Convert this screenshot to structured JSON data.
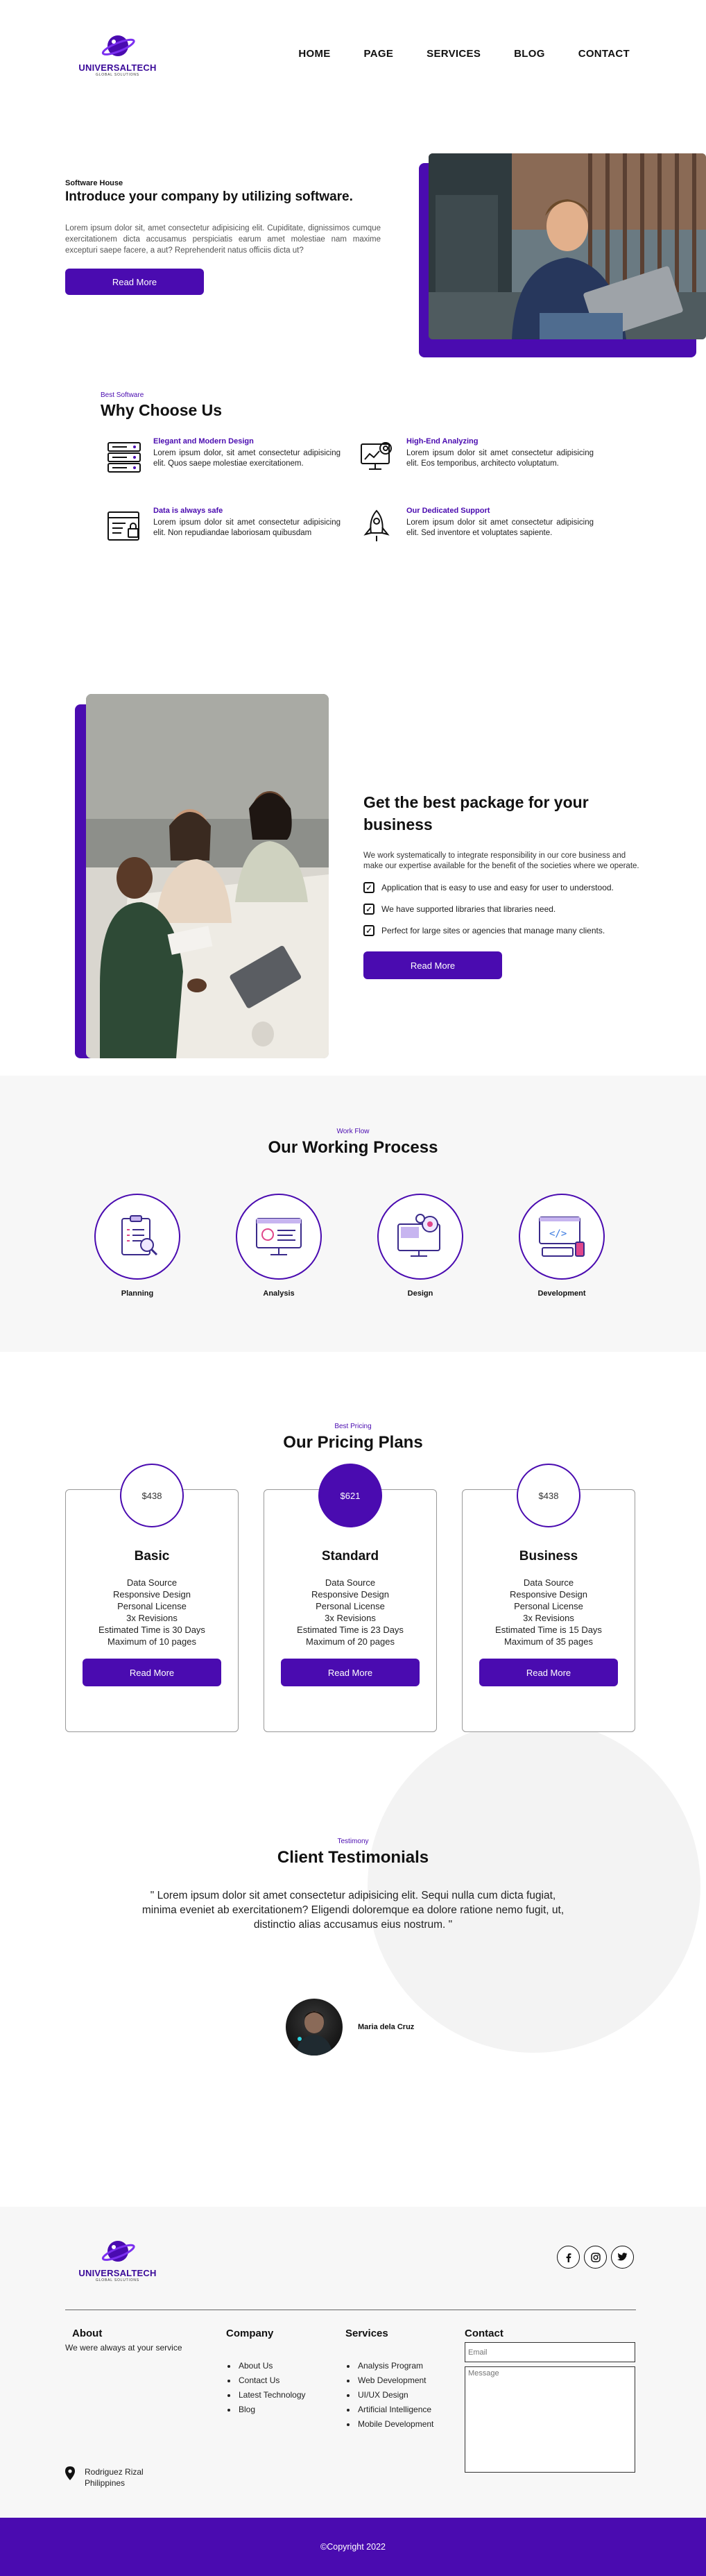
{
  "brand": {
    "name_part1": "UNIVERSAL",
    "name_part2": "TECH",
    "tagline": "GLOBAL SOLUTIONS"
  },
  "nav": {
    "items": [
      "HOME",
      "PAGE",
      "SERVICES",
      "BLOG",
      "CONTACT"
    ]
  },
  "hero": {
    "eyebrow": "Software House",
    "title": "Introduce your company by utilizing software.",
    "body": "Lorem ipsum dolor sit, amet consectetur adipisicing elit. Cupiditate, dignissimos cumque exercitationem dicta accusamus perspiciatis earum amet molestiae nam maxime excepturi saepe facere, a aut? Reprehenderit natus officiis dicta ut?",
    "button": "Read More"
  },
  "why": {
    "eyebrow": "Best Software",
    "title": "Why Choose Us",
    "features": [
      {
        "title": "Elegant and Modern Design",
        "desc": "Lorem ipsum dolor, sit amet consectetur adipisicing elit. Quos saepe molestiae exercitationem.",
        "icon": "server-stack-icon"
      },
      {
        "title": "High-End Analyzing",
        "desc": "Lorem ipsum dolor sit amet consectetur adipisicing elit. Eos temporibus, architecto voluptatum.",
        "icon": "monitor-gear-icon"
      },
      {
        "title": "Data is always safe",
        "desc": "Lorem ipsum dolor sit amet consectetur adipisicing elit. Non repudiandae laboriosam quibusdam",
        "icon": "secure-form-icon"
      },
      {
        "title": "Our Dedicated Support",
        "desc": "Lorem ipsum dolor sit amet consectetur adipisicing elit. Sed inventore et voluptates sapiente.",
        "icon": "rocket-icon"
      }
    ]
  },
  "package": {
    "title": "Get the best package for your business",
    "body": "We work systematically to integrate responsibility in our core business and make our expertise available for the benefit of the societies where we operate.",
    "checks": [
      "Application that is easy to use and easy for user to understood.",
      "We have supported libraries that libraries need.",
      "Perfect for large sites or agencies that manage many clients."
    ],
    "button": "Read More"
  },
  "process": {
    "eyebrow": "Work Flow",
    "title": "Our Working Process",
    "steps": [
      {
        "label": "Planning",
        "icon": "clipboard-icon"
      },
      {
        "label": "Analysis",
        "icon": "analytics-monitor-icon"
      },
      {
        "label": "Design",
        "icon": "design-gears-icon"
      },
      {
        "label": "Development",
        "icon": "code-monitor-icon"
      }
    ]
  },
  "pricing": {
    "eyebrow": "Best Pricing",
    "title": "Our Pricing Plans",
    "plans": [
      {
        "price": "$438",
        "name": "Basic",
        "features": [
          "Data Source",
          "Responsive Design",
          "Personal License",
          "3x Revisions",
          "Estimated Time is 30 Days",
          "Maximum of 10 pages"
        ],
        "button": "Read More",
        "highlight": false
      },
      {
        "price": "$621",
        "name": "Standard",
        "features": [
          "Data Source",
          "Responsive Design",
          "Personal License",
          "3x Revisions",
          "Estimated Time is 23 Days",
          "Maximum of 20 pages"
        ],
        "button": "Read More",
        "highlight": true
      },
      {
        "price": "$438",
        "name": "Business",
        "features": [
          "Data Source",
          "Responsive Design",
          "Personal License",
          "3x Revisions",
          "Estimated Time is 15 Days",
          "Maximum of 35 pages"
        ],
        "button": "Read More",
        "highlight": false
      }
    ]
  },
  "testimonial": {
    "eyebrow": "Testimony",
    "title": "Client Testimonials",
    "quote": "\" Lorem ipsum dolor sit amet consectetur adipisicing elit. Sequi nulla cum dicta fugiat, minima eveniet ab exercitationem? Eligendi doloremque ea dolore ratione nemo fugit, ut, distinctio alias accusamus eius nostrum. \"",
    "author": "Maria dela Cruz"
  },
  "footer": {
    "about": {
      "title": "About",
      "text": "We were always at your service"
    },
    "company": {
      "title": "Company",
      "links": [
        "About Us",
        "Contact Us",
        "Latest Technology",
        "Blog"
      ]
    },
    "services": {
      "title": "Services",
      "links": [
        "Analysis Program",
        "Web Development",
        "UI/UX Design",
        "Artificial Intelligence",
        "Mobile Development"
      ]
    },
    "contact": {
      "title": "Contact",
      "email_placeholder": "Email",
      "message_placeholder": "Message"
    },
    "location": {
      "line1": "Rodriguez Rizal",
      "line2": "Philippines"
    },
    "socials": [
      "facebook-icon",
      "instagram-icon",
      "twitter-icon"
    ],
    "copyright": "©Copyright 2022"
  },
  "colors": {
    "accent": "#4a0bb0"
  }
}
